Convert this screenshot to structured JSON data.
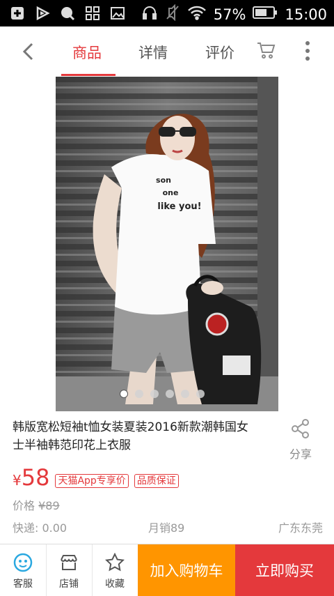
{
  "status": {
    "battery": "57%",
    "time": "15:00"
  },
  "nav": {
    "tabs": [
      {
        "label": "商品"
      },
      {
        "label": "详情"
      },
      {
        "label": "评价"
      }
    ]
  },
  "product": {
    "title": "韩版宽松短袖t恤女装夏装2016新款潮韩国女士半袖韩范印花上衣服",
    "share_label": "分享",
    "shirt_text": [
      "son",
      "one",
      "like you!"
    ],
    "currency": "¥",
    "price": "58",
    "tags": [
      "天猫App专享价",
      "品质保证"
    ],
    "original_price_label": "价格",
    "original_price": "¥89",
    "shipping": "快递: 0.00",
    "monthly_sales": "月销89",
    "location": "广东东莞"
  },
  "carousel": {
    "count": 6,
    "active": 0
  },
  "bottom": {
    "service": "客服",
    "shop": "店铺",
    "favorite": "收藏",
    "add_to_cart": "加入购物车",
    "buy_now": "立即购买"
  },
  "colors": {
    "accent": "#e4393c",
    "orange": "#ff9500"
  }
}
